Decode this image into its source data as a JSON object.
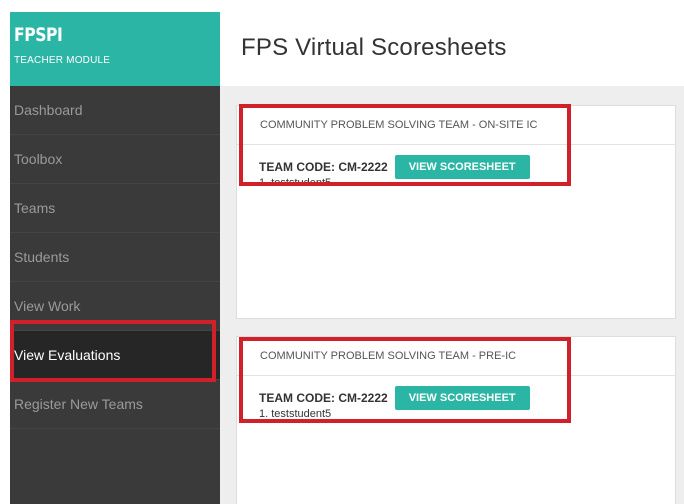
{
  "sidebar": {
    "brand": "FPSPI",
    "module": "TEACHER MODULE",
    "items": [
      {
        "label": "Dashboard"
      },
      {
        "label": "Toolbox"
      },
      {
        "label": "Teams"
      },
      {
        "label": "Students"
      },
      {
        "label": "View Work"
      },
      {
        "label": "View Evaluations"
      },
      {
        "label": "Register New Teams"
      }
    ]
  },
  "page": {
    "title": "FPS Virtual Scoresheets"
  },
  "cards": [
    {
      "heading": "COMMUNITY PROBLEM SOLVING TEAM - ON-SITE IC",
      "team_code": "TEAM CODE: CM-2222",
      "button": "VIEW SCORESHEET",
      "student": "1. teststudent5"
    },
    {
      "heading": "COMMUNITY PROBLEM SOLVING TEAM - PRE-IC",
      "team_code": "TEAM CODE: CM-2222",
      "button": "VIEW SCORESHEET",
      "student": "1. teststudent5"
    }
  ],
  "colors": {
    "accent": "#2bb5a4",
    "sidebar_bg": "#3a3a3a",
    "highlight": "#d0202a"
  }
}
